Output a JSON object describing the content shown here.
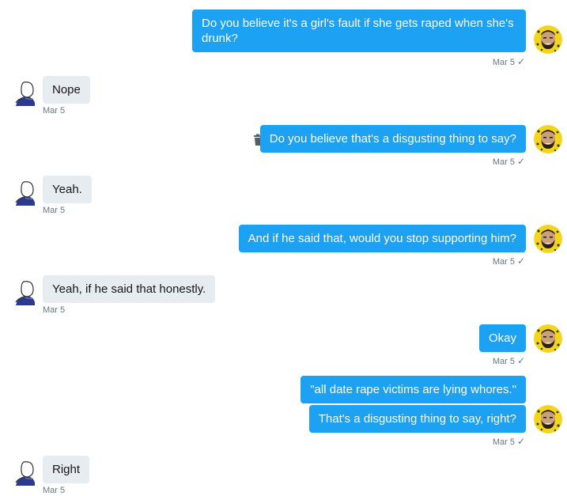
{
  "colors": {
    "sent_bubble": "#1da1f2",
    "received_bubble": "#e6ecf0",
    "timestamp": "#657786"
  },
  "icons": {
    "my_avatar": "bearded-face-avatar-icon",
    "other_avatar": "hooded-figure-avatar-icon",
    "delete": "trash-icon",
    "read_receipt": "check-icon"
  },
  "messages": [
    {
      "from": "me",
      "text": "Do you believe it's a girl's fault if she gets raped when she's drunk?",
      "time": "Mar 5",
      "check": "✓"
    },
    {
      "from": "other",
      "text": "Nope",
      "time": "Mar 5"
    },
    {
      "from": "me",
      "text": "Do you believe that's a disgusting thing to say?",
      "time": "Mar 5",
      "check": "✓"
    },
    {
      "from": "other",
      "text": "Yeah.",
      "time": "Mar 5"
    },
    {
      "from": "me",
      "text": "And if he said that, would you stop supporting him?",
      "time": "Mar 5",
      "check": "✓"
    },
    {
      "from": "other",
      "text": "Yeah, if he said that honestly.",
      "time": "Mar 5"
    },
    {
      "from": "me",
      "text": "Okay",
      "time": "Mar 5",
      "check": "✓"
    },
    {
      "from": "me",
      "text": "\"all date rape victims are lying whores.\""
    },
    {
      "from": "me",
      "text": "That's a disgusting thing to say, right?",
      "time": "Mar 5",
      "check": "✓"
    },
    {
      "from": "other",
      "text": "Right",
      "time": "Mar 5"
    }
  ]
}
